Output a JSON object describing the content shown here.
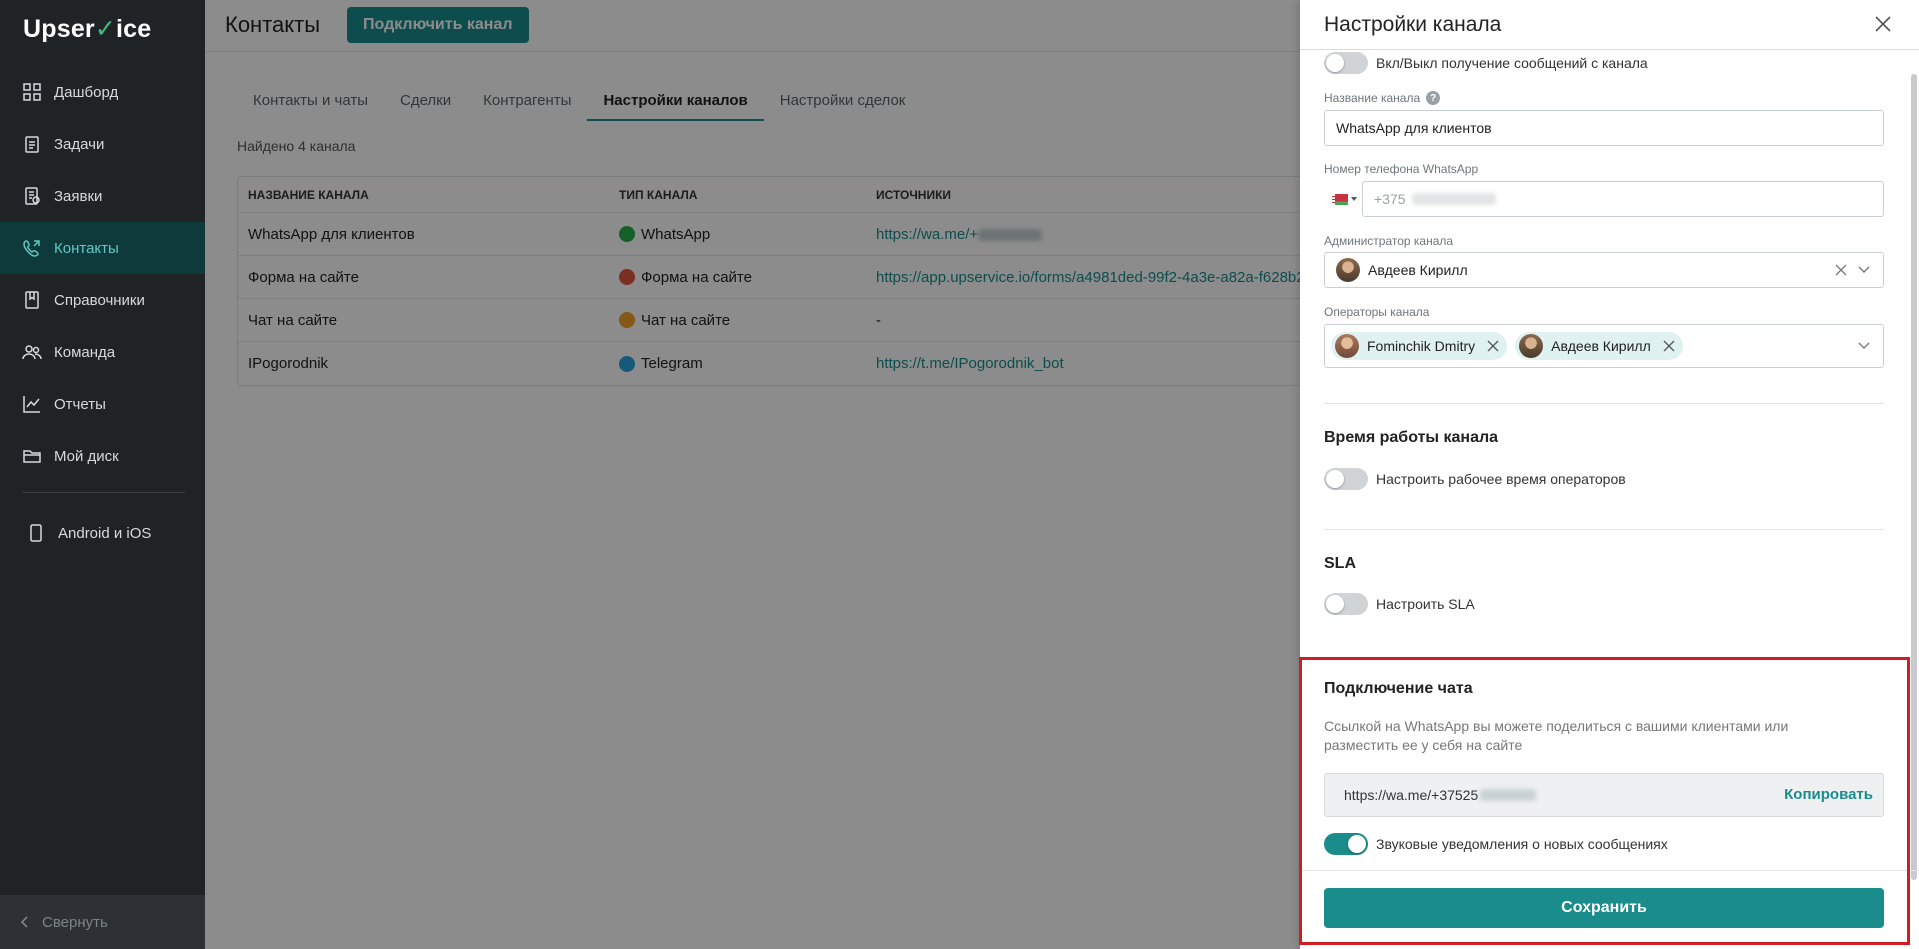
{
  "app": {
    "logo_pre": "Upser",
    "logo_post": "ice"
  },
  "sidebar": {
    "items": [
      {
        "label": "Дашборд",
        "icon": "dashboard-icon"
      },
      {
        "label": "Задачи",
        "icon": "tasks-icon"
      },
      {
        "label": "Заявки",
        "icon": "requests-icon"
      },
      {
        "label": "Контакты",
        "icon": "contacts-icon",
        "active": true
      },
      {
        "label": "Справочники",
        "icon": "directory-icon"
      },
      {
        "label": "Команда",
        "icon": "team-icon"
      },
      {
        "label": "Отчеты",
        "icon": "reports-icon"
      },
      {
        "label": "Мой диск",
        "icon": "folder-icon"
      }
    ],
    "mobile": "Android и iOS",
    "collapse": "Свернуть"
  },
  "header": {
    "title": "Контакты",
    "connect_button": "Подключить канал"
  },
  "tabs": [
    "Контакты и чаты",
    "Сделки",
    "Контрагенты",
    "Настройки каналов",
    "Настройки сделок"
  ],
  "found_text": "Найдено 4 канала",
  "table": {
    "columns": [
      "НАЗВАНИЕ КАНАЛА",
      "ТИП КАНАЛА",
      "ИСТОЧНИКИ"
    ],
    "rows": [
      {
        "name": "WhatsApp для клиентов",
        "type": "WhatsApp",
        "source": "https://wa.me/+",
        "type_color": "#25b04a"
      },
      {
        "name": "Форма на сайте",
        "type": "Форма на сайте",
        "source": "https://app.upservice.io/forms/a4981ded-99f2-4a3e-a82a-f628b2...",
        "type_color": "#e0573c"
      },
      {
        "name": "Чат на сайте",
        "type": "Чат на сайте",
        "source": "-",
        "type_color": "#f0a32a"
      },
      {
        "name": "IPogorodnik",
        "type": "Telegram",
        "source": "https://t.me/IPogorodnik_bot",
        "type_color": "#2aa3dd"
      }
    ]
  },
  "drawer": {
    "title": "Настройки канала",
    "toggle_receive": "Вкл/Выкл получение сообщений с канала",
    "channel_name_label": "Название канала",
    "channel_name_value": "WhatsApp для клиентов",
    "phone_label": "Номер телефона WhatsApp",
    "phone_value": "+375",
    "admin_label": "Администратор канала",
    "admin_value": "Авдеев Кирилл",
    "operators_label": "Операторы канала",
    "operators": [
      "Fominchik Dmitry",
      "Авдеев Кирилл"
    ],
    "work_time_title": "Время работы канала",
    "work_time_toggle": "Настроить рабочее время операторов",
    "sla_title": "SLA",
    "sla_toggle": "Настроить SLA",
    "chat_title": "Подключение чата",
    "chat_desc": "Ссылкой на WhatsApp вы можете поделиться с вашими клиентами или разместить ее у себя на сайте",
    "chat_link": "https://wa.me/+37525",
    "copy_button": "Копировать",
    "sound_toggle": "Звуковые уведомления о новых сообщениях",
    "save_button": "Сохранить"
  }
}
